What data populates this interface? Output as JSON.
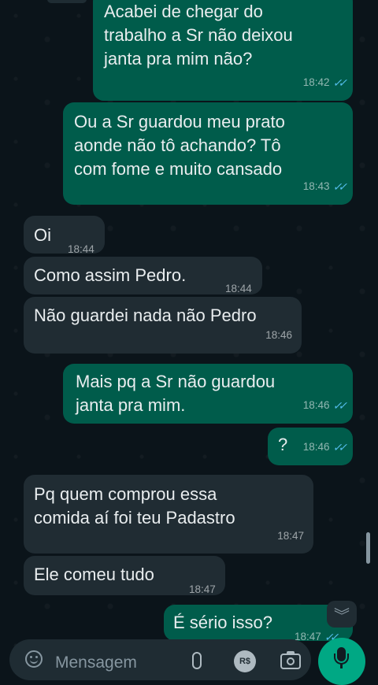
{
  "messages": [
    {
      "dir": "out",
      "text": "Acabei de chegar do\ntrabalho a Sr não deixou\njanta pra mim não?",
      "time": "18:42",
      "read": true
    },
    {
      "dir": "out",
      "text": "Ou a Sr guardou meu prato\naonde não tô achando? Tô\ncom fome e muito cansado",
      "time": "18:43",
      "read": true
    },
    {
      "dir": "in",
      "text": "Oi",
      "time": "18:44"
    },
    {
      "dir": "in",
      "text": "Como assim Pedro.",
      "time": "18:44"
    },
    {
      "dir": "in",
      "text": "Não guardei nada não Pedro",
      "time": "18:46"
    },
    {
      "dir": "out",
      "text": "Mais pq a Sr não guardou\njanta pra mim.",
      "time": "18:46",
      "read": true
    },
    {
      "dir": "out",
      "text": "?",
      "time": "18:46",
      "read": true
    },
    {
      "dir": "in",
      "text": "Pq quem comprou essa\ncomida aí foi teu Padastro",
      "time": "18:47"
    },
    {
      "dir": "in",
      "text": "Ele comeu tudo",
      "time": "18:47"
    },
    {
      "dir": "out",
      "text": "É sério isso?",
      "time": "18:47",
      "read": true
    }
  ],
  "composer": {
    "placeholder": "Mensagem",
    "payment_label": "R$"
  },
  "colors": {
    "bg": "#0b141a",
    "outgoing": "#005c4b",
    "incoming": "#202c33",
    "accent": "#00a884",
    "read_ticks": "#53bdeb"
  },
  "icons": {
    "emoji": "emoji-icon",
    "attach": "paperclip-icon",
    "payment": "payment-icon",
    "camera": "camera-icon",
    "mic": "mic-icon",
    "scroll": "chevron-double-down-icon"
  }
}
